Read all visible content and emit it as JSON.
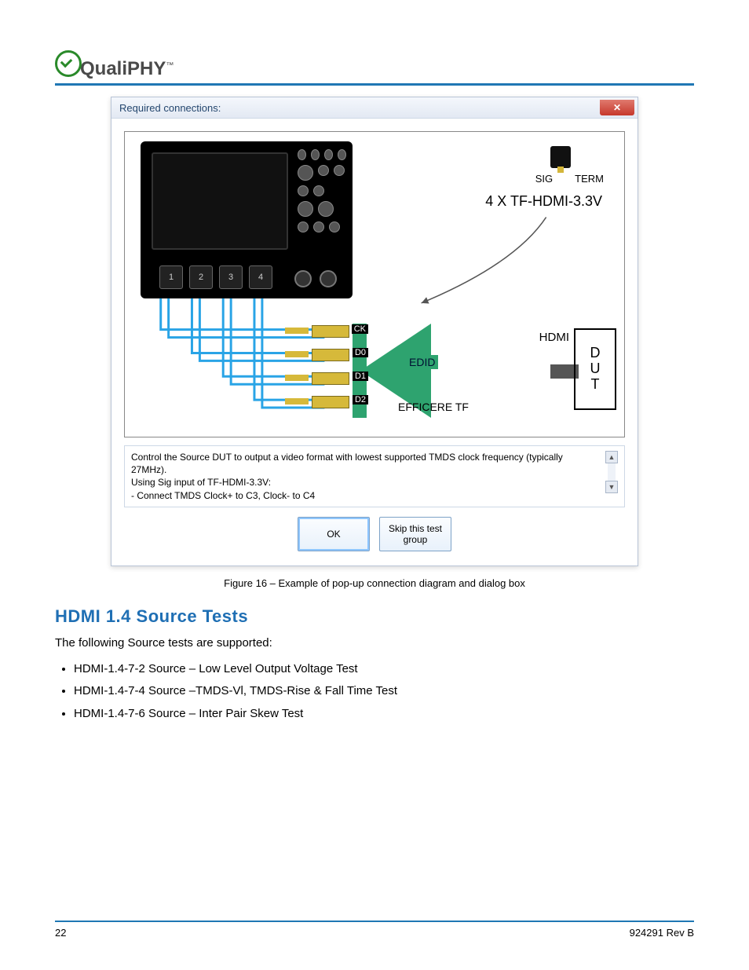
{
  "brand": {
    "name": "QualiPHY",
    "tm": "™"
  },
  "dialog": {
    "title": "Required connections:",
    "close_glyph": "✕",
    "probe": {
      "sig": "SIG",
      "term": "TERM",
      "title": "4 X TF-HDMI-3.3V"
    },
    "channels": [
      "1",
      "2",
      "3",
      "4"
    ],
    "lanes": {
      "ck": "CK",
      "d0": "D0",
      "d1": "D1",
      "d2": "D2"
    },
    "edid": "EDID",
    "efficere": "EFFICERE TF",
    "hdmi": "HDMI",
    "dut": "D\nU\nT",
    "instructions": "Control the Source DUT to output a video format with lowest supported TMDS clock frequency (typically 27MHz).\nUsing Sig input of TF-HDMI-3.3V:\n- Connect TMDS Clock+ to C3, Clock- to C4",
    "ok": "OK",
    "skip": "Skip this test\ngroup"
  },
  "caption": "Figure 16 – Example of pop-up connection diagram and dialog box",
  "heading": "HDMI 1.4 Source Tests",
  "intro": "The following Source tests are supported:",
  "tests": [
    "HDMI-1.4-7-2 Source – Low Level Output Voltage Test",
    "HDMI-1.4-7-4 Source –TMDS-Vl, TMDS-Rise & Fall Time Test",
    "HDMI-1.4-7-6 Source – Inter Pair Skew Test"
  ],
  "footer": {
    "page": "22",
    "rev": "924291 Rev B"
  }
}
